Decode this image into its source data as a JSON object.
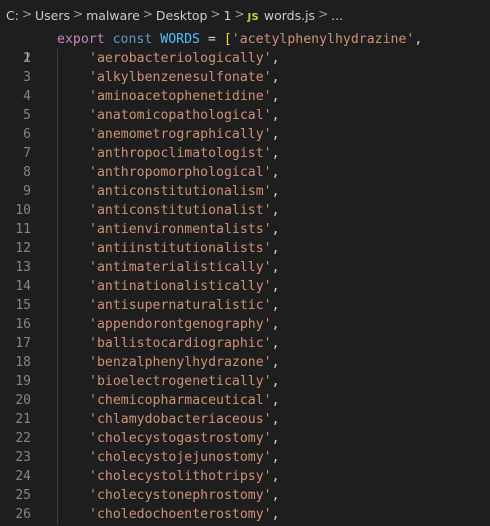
{
  "breadcrumb": {
    "items": [
      "C:",
      "Users",
      "malware",
      "Desktop",
      "1"
    ],
    "file_badge": "JS",
    "file_name": "words.js",
    "ellipsis": "...",
    "separator": ">"
  },
  "editor": {
    "language": "javascript",
    "first_line": {
      "number": "1",
      "export_kw": "export",
      "const_kw": "const",
      "identifier": "WORDS",
      "equals": "=",
      "open_bracket": "[",
      "first_value": "'acetylphenylhydrazine'",
      "comma": ","
    },
    "lines": [
      {
        "number": "2",
        "value": "'aerobacteriologically'"
      },
      {
        "number": "3",
        "value": "'alkylbenzenesulfonate'"
      },
      {
        "number": "4",
        "value": "'aminoacetophenetidine'"
      },
      {
        "number": "5",
        "value": "'anatomicopathological'"
      },
      {
        "number": "6",
        "value": "'anemometrographically'"
      },
      {
        "number": "7",
        "value": "'anthropoclimatologist'"
      },
      {
        "number": "8",
        "value": "'anthropomorphological'"
      },
      {
        "number": "9",
        "value": "'anticonstitutionalism'"
      },
      {
        "number": "10",
        "value": "'anticonstitutionalist'"
      },
      {
        "number": "11",
        "value": "'antienvironmentalists'"
      },
      {
        "number": "12",
        "value": "'antiinstitutionalists'"
      },
      {
        "number": "13",
        "value": "'antimaterialistically'"
      },
      {
        "number": "14",
        "value": "'antinationalistically'"
      },
      {
        "number": "15",
        "value": "'antisupernaturalistic'"
      },
      {
        "number": "16",
        "value": "'appendorontgenography'"
      },
      {
        "number": "17",
        "value": "'ballistocardiographic'"
      },
      {
        "number": "18",
        "value": "'benzalphenylhydrazone'"
      },
      {
        "number": "19",
        "value": "'bioelectrogenetically'"
      },
      {
        "number": "20",
        "value": "'chemicopharmaceutical'"
      },
      {
        "number": "21",
        "value": "'chlamydobacteriaceous'"
      },
      {
        "number": "22",
        "value": "'cholecystogastrostomy'"
      },
      {
        "number": "23",
        "value": "'cholecystojejunostomy'"
      },
      {
        "number": "24",
        "value": "'cholecystolithotripsy'"
      },
      {
        "number": "25",
        "value": "'cholecystonephrostomy'"
      },
      {
        "number": "26",
        "value": "'choledochoenterostomy'"
      }
    ],
    "line_comma": ","
  },
  "colors": {
    "background": "#1e1e1e",
    "keyword_export": "#c586c0",
    "keyword_const": "#569cd6",
    "identifier": "#4fc1ff",
    "string": "#ce9178",
    "bracket": "#ffd700",
    "line_number": "#858585",
    "active_line_number": "#c6c6c6"
  }
}
